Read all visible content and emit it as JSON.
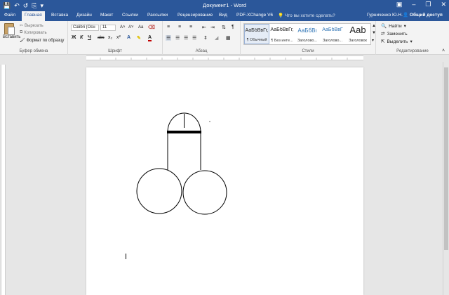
{
  "titlebar": {
    "title": "Документ1 - Word",
    "qat_icons": [
      "save-icon",
      "undo-icon",
      "redo-icon",
      "print-icon",
      "customize-icon"
    ],
    "controls": [
      "minimize-icon",
      "restore-icon",
      "close-icon"
    ]
  },
  "tabs": {
    "items": [
      "Файл",
      "Главная",
      "Вставка",
      "Дизайн",
      "Макет",
      "Ссылки",
      "Рассылки",
      "Рецензирование",
      "Вид",
      "PDF-XChange V6"
    ],
    "active": "Главная",
    "tell_me": "Что вы хотите сделать?",
    "user": "Гурниченко Ю.Н.",
    "share": "Общий доступ"
  },
  "ribbon": {
    "clipboard": {
      "paste": "Вставить",
      "cut": "Вырезать",
      "copy": "Копировать",
      "format_painter": "Формат по образцу",
      "label": "Буфер обмена"
    },
    "font": {
      "font_name": "Calibri (Осн",
      "font_size": "11",
      "grow": "A˄",
      "shrink": "A˅",
      "case": "Aa",
      "bold": "Ж",
      "italic": "К",
      "underline": "Ч",
      "strike": "abc",
      "sub": "x₂",
      "sup": "x²",
      "label": "Шрифт"
    },
    "paragraph": {
      "label": "Абзац",
      "pilcrow": "¶"
    },
    "styles": {
      "label": "Стили",
      "items": [
        {
          "sample": "АаБбВвГг,",
          "name": "¶ Обычный"
        },
        {
          "sample": "АаБбВвГг,",
          "name": "¶ Без инте..."
        },
        {
          "sample": "АаБбВı",
          "name": "Заголово..."
        },
        {
          "sample": "АаБбВвГ",
          "name": "Заголово..."
        },
        {
          "sample": "Aab",
          "name": "Заголовок"
        }
      ]
    },
    "editing": {
      "find": "Найти",
      "replace": "Заменить",
      "select": "Выделить",
      "label": "Редактирование"
    }
  },
  "colors": {
    "accent": "#2b579a",
    "ribbon_bg": "#f3f3f3",
    "workspace": "#e6e6e6"
  }
}
